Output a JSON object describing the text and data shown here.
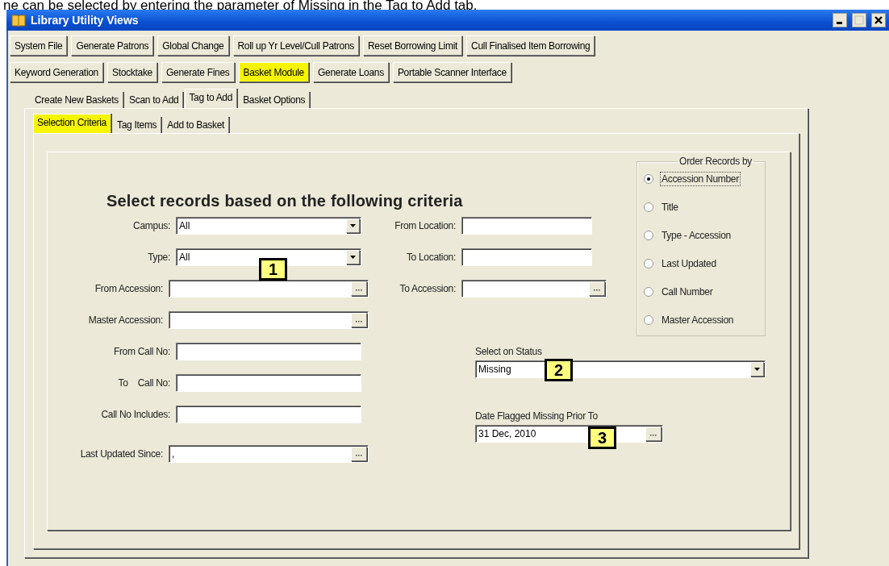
{
  "caption": "ne can be selected by entering the parameter of Missing in the Tag to Add tab.",
  "window": {
    "title": "Library Utility Views"
  },
  "toolbar_rows": [
    [
      {
        "label": "System File",
        "highlighted": false
      },
      {
        "label": "Generate Patrons",
        "highlighted": false
      },
      {
        "label": "Global Change",
        "highlighted": false
      },
      {
        "label": "Roll up Yr Level/Cull Patrons",
        "highlighted": false
      },
      {
        "label": "Reset Borrowing Limit",
        "highlighted": false
      },
      {
        "label": "Cull Finalised Item Borrowing",
        "highlighted": false
      }
    ],
    [
      {
        "label": "Keyword Generation",
        "highlighted": false
      },
      {
        "label": "Stocktake",
        "highlighted": false
      },
      {
        "label": "Generate Fines",
        "highlighted": false
      },
      {
        "label": "Basket Module",
        "highlighted": true
      },
      {
        "label": "Generate Loans",
        "highlighted": false
      },
      {
        "label": "Portable Scanner Interface",
        "highlighted": false
      }
    ]
  ],
  "tabs": [
    {
      "label": "Create New Baskets",
      "selected": false
    },
    {
      "label": "Scan to Add",
      "selected": false
    },
    {
      "label": "Tag to Add",
      "selected": true
    },
    {
      "label": "Basket Options",
      "selected": false
    }
  ],
  "subtabs": [
    {
      "label": "Selection Criteria",
      "selected": true,
      "highlighted": true
    },
    {
      "label": "Tag Items",
      "selected": false,
      "highlighted": false
    },
    {
      "label": "Add to Basket",
      "selected": false,
      "highlighted": false
    }
  ],
  "heading": "Select records based on the following criteria",
  "left_fields": [
    {
      "label": "Campus:",
      "kind": "dropdown",
      "value": "All"
    },
    {
      "label": "Type:",
      "kind": "dropdown",
      "value": "All",
      "callout": "1"
    },
    {
      "label": "From Accession:",
      "kind": "lookup"
    },
    {
      "label": "Master Accession:",
      "kind": "lookup"
    },
    {
      "label": "From Call No:",
      "kind": "text"
    },
    {
      "label": "To    Call No:",
      "kind": "text"
    },
    {
      "label": "Call No Includes:",
      "kind": "text"
    },
    {
      "label": "Last Updated Since:",
      "kind": "lookup",
      "value": ","
    }
  ],
  "middle_fields": [
    {
      "label": "From Location:",
      "kind": "text"
    },
    {
      "label": "To Location:",
      "kind": "text"
    },
    {
      "label": "To Accession:",
      "kind": "lookup"
    }
  ],
  "order_group": {
    "title": "Order Records by",
    "options": [
      {
        "label": "Accession Number",
        "selected": true
      },
      {
        "label": "Title",
        "selected": false
      },
      {
        "label": "Type - Accession",
        "selected": false
      },
      {
        "label": "Last Updated",
        "selected": false
      },
      {
        "label": "Call Number",
        "selected": false
      },
      {
        "label": "Master Accession",
        "selected": false
      }
    ]
  },
  "status": {
    "label": "Select on Status",
    "value": "Missing",
    "callout": "2"
  },
  "date": {
    "label": "Date Flagged Missing Prior To",
    "value": "31 Dec, 2010",
    "callout": "3"
  }
}
